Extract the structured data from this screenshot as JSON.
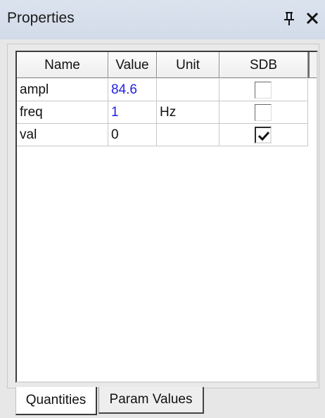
{
  "window": {
    "title": "Properties"
  },
  "grid": {
    "columns": [
      "Name",
      "Value",
      "Unit",
      "SDB"
    ],
    "rows": [
      {
        "name": "ampl",
        "value": "84.6",
        "unit": "",
        "sdb": false,
        "value_color": "#1e1ee6"
      },
      {
        "name": "freq",
        "value": "1",
        "unit": "Hz",
        "sdb": false,
        "value_color": "#1e1ee6"
      },
      {
        "name": "val",
        "value": "0",
        "unit": "",
        "sdb": true,
        "value_color": "#111111"
      }
    ]
  },
  "tabs": [
    {
      "label": "Quantities",
      "active": true
    },
    {
      "label": "Param Values",
      "active": false
    }
  ],
  "icons": {
    "pin": "pin-icon",
    "close": "close-icon",
    "check": "checkmark-icon"
  },
  "colors": {
    "titlebar": "#d6deea",
    "value_blue": "#1e1ee6"
  }
}
